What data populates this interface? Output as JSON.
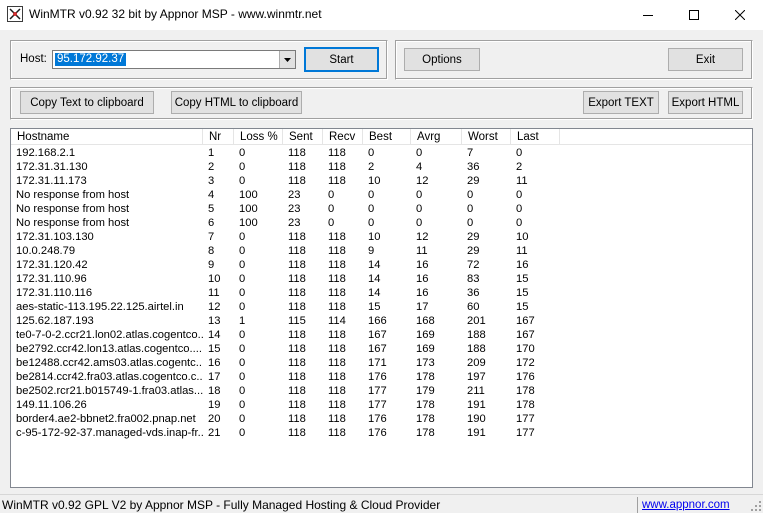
{
  "window": {
    "title": "WinMTR v0.92 32 bit by Appnor MSP - www.winmtr.net",
    "icon": "winmtr-app-icon"
  },
  "host": {
    "label": "Host:",
    "value": "95.172.92.37"
  },
  "buttons": {
    "start": "Start",
    "options": "Options",
    "exit": "Exit",
    "copy_text": "Copy Text to clipboard",
    "copy_html": "Copy HTML to clipboard",
    "export_text": "Export TEXT",
    "export_html": "Export HTML"
  },
  "table": {
    "columns": [
      "Hostname",
      "Nr",
      "Loss %",
      "Sent",
      "Recv",
      "Best",
      "Avrg",
      "Worst",
      "Last"
    ],
    "rows": [
      [
        "192.168.2.1",
        "1",
        "0",
        "118",
        "118",
        "0",
        "0",
        "7",
        "0"
      ],
      [
        "172.31.31.130",
        "2",
        "0",
        "118",
        "118",
        "2",
        "4",
        "36",
        "2"
      ],
      [
        "172.31.11.173",
        "3",
        "0",
        "118",
        "118",
        "10",
        "12",
        "29",
        "11"
      ],
      [
        "No response from host",
        "4",
        "100",
        "23",
        "0",
        "0",
        "0",
        "0",
        "0"
      ],
      [
        "No response from host",
        "5",
        "100",
        "23",
        "0",
        "0",
        "0",
        "0",
        "0"
      ],
      [
        "No response from host",
        "6",
        "100",
        "23",
        "0",
        "0",
        "0",
        "0",
        "0"
      ],
      [
        "172.31.103.130",
        "7",
        "0",
        "118",
        "118",
        "10",
        "12",
        "29",
        "10"
      ],
      [
        "10.0.248.79",
        "8",
        "0",
        "118",
        "118",
        "9",
        "11",
        "29",
        "11"
      ],
      [
        "172.31.120.42",
        "9",
        "0",
        "118",
        "118",
        "14",
        "16",
        "72",
        "16"
      ],
      [
        "172.31.110.96",
        "10",
        "0",
        "118",
        "118",
        "14",
        "16",
        "83",
        "15"
      ],
      [
        "172.31.110.116",
        "11",
        "0",
        "118",
        "118",
        "14",
        "16",
        "36",
        "15"
      ],
      [
        "aes-static-113.195.22.125.airtel.in",
        "12",
        "0",
        "118",
        "118",
        "15",
        "17",
        "60",
        "15"
      ],
      [
        "125.62.187.193",
        "13",
        "1",
        "115",
        "114",
        "166",
        "168",
        "201",
        "167"
      ],
      [
        "te0-7-0-2.ccr21.lon02.atlas.cogentco...",
        "14",
        "0",
        "118",
        "118",
        "167",
        "169",
        "188",
        "167"
      ],
      [
        "be2792.ccr42.lon13.atlas.cogentco....",
        "15",
        "0",
        "118",
        "118",
        "167",
        "169",
        "188",
        "170"
      ],
      [
        "be12488.ccr42.ams03.atlas.cogentc...",
        "16",
        "0",
        "118",
        "118",
        "171",
        "173",
        "209",
        "172"
      ],
      [
        "be2814.ccr42.fra03.atlas.cogentco.c...",
        "17",
        "0",
        "118",
        "118",
        "176",
        "178",
        "197",
        "176"
      ],
      [
        "be2502.rcr21.b015749-1.fra03.atlas....",
        "18",
        "0",
        "118",
        "118",
        "177",
        "179",
        "211",
        "178"
      ],
      [
        "149.11.106.26",
        "19",
        "0",
        "118",
        "118",
        "177",
        "178",
        "191",
        "178"
      ],
      [
        "border4.ae2-bbnet2.fra002.pnap.net",
        "20",
        "0",
        "118",
        "118",
        "176",
        "178",
        "190",
        "177"
      ],
      [
        "c-95-172-92-37.managed-vds.inap-fr...",
        "21",
        "0",
        "118",
        "118",
        "176",
        "178",
        "191",
        "177"
      ]
    ]
  },
  "status": {
    "text": "WinMTR v0.92 GPL V2 by Appnor MSP - Fully Managed Hosting & Cloud Provider",
    "link": "www.appnor.com"
  },
  "colors": {
    "selection": "#0078d7",
    "link": "#0000ee"
  }
}
